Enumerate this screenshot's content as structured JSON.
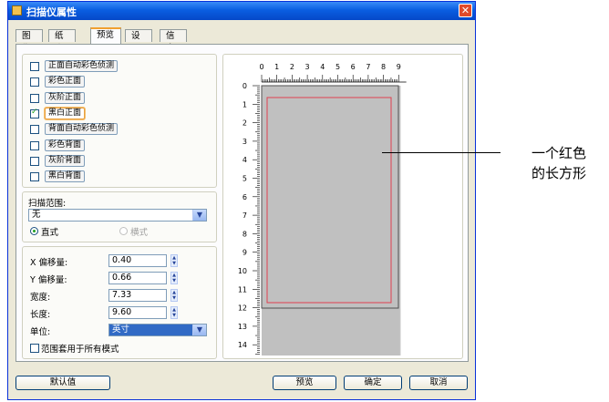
{
  "window": {
    "title": "扫描仪属性",
    "close_glyph": "✕"
  },
  "tabs": [
    "图像",
    "纸张",
    "预览",
    "设置",
    "信息"
  ],
  "image_options": [
    {
      "label": "正面自动彩色侦测",
      "checked": false
    },
    {
      "label": "彩色正面",
      "checked": false
    },
    {
      "label": "灰阶正面",
      "checked": false
    },
    {
      "label": "黑白正面",
      "checked": true
    },
    {
      "label": "背面自动彩色侦测",
      "checked": false
    },
    {
      "label": "彩色背面",
      "checked": false
    },
    {
      "label": "灰阶背面",
      "checked": false
    },
    {
      "label": "黑白背面",
      "checked": false
    }
  ],
  "scan_area": {
    "label": "扫描范围:",
    "value": "无",
    "orientation": {
      "portrait": "直式",
      "landscape": "横式",
      "selected": "portrait"
    }
  },
  "fields": [
    {
      "label": "X 偏移量:",
      "value": "0.40"
    },
    {
      "label": "Y 偏移量:",
      "value": "0.66"
    },
    {
      "label": "宽度:",
      "value": "7.33"
    },
    {
      "label": "长度:",
      "value": "9.60"
    }
  ],
  "unit": {
    "label": "单位:",
    "value": "英寸"
  },
  "apply_all": {
    "label": "范围套用于所有模式",
    "checked": false
  },
  "ruler": {
    "x_ticks": [
      "0",
      "1",
      "2",
      "3",
      "4",
      "5",
      "6",
      "7",
      "8",
      "9"
    ],
    "y_ticks": [
      "0",
      "1",
      "2",
      "3",
      "4",
      "5",
      "6",
      "7",
      "8",
      "9",
      "10",
      "11",
      "12",
      "13",
      "14"
    ]
  },
  "buttons": {
    "default": "默认值",
    "preview": "预览",
    "ok": "确定",
    "cancel": "取消"
  },
  "annotation": "一个红色的长方形",
  "colors": {
    "title_bar": "#0a5ee1",
    "selection_rect": "#e04050",
    "scan_area_fill": "#c0c0c0"
  }
}
